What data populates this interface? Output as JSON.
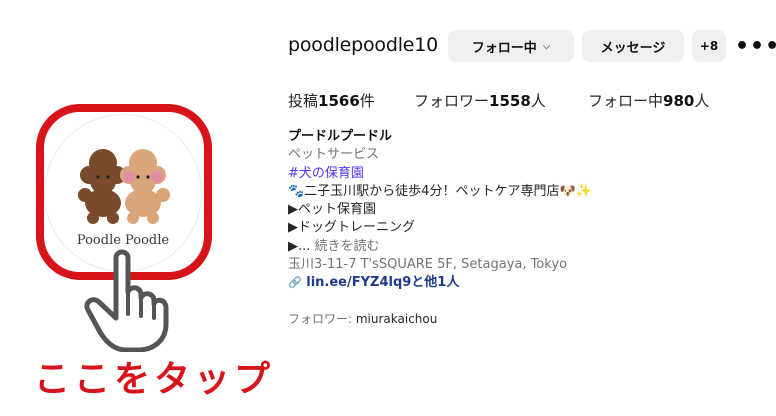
{
  "profile": {
    "username": "poodlepoodle10",
    "avatar_logo_text": "Poodle Poodle"
  },
  "actions": {
    "follow_label": "フォロー中",
    "follow_chevron": "⌵",
    "message_label": "メッセージ",
    "adduser_icon": "+8",
    "more_icon": "•••"
  },
  "stats": {
    "posts_label": "投稿",
    "posts_value": "1566",
    "posts_unit": "件",
    "followers_label": "フォロワー",
    "followers_value": "1558",
    "followers_unit": "人",
    "following_label": "フォロー中",
    "following_value": "980",
    "following_unit": "人"
  },
  "bio": {
    "name": "プードルプードル",
    "category": "ペットサービス",
    "hashtag": "#犬の保育園",
    "line1": "🐾二子玉川駅から徒歩4分！ペットケア専門店🐶✨",
    "line2": "▶ペット保育園",
    "line3": "▶ドッグトレーニング",
    "line4_prefix": "▶...",
    "line4_more": "続きを読む",
    "address": "玉川3-11-7 T'sSQUARE 5F, Setagaya, Tokyo",
    "link_icon": "🔗",
    "link_text": "lin.ee/FYZ4lq9と他1人"
  },
  "followed_by": {
    "label": "フォロワー: ",
    "user": "miurakaichou"
  },
  "annotation": {
    "caption": "ここをタップ"
  },
  "colors": {
    "highlight_red": "#d8141b",
    "button_bg": "#efefef",
    "hashtag": "#4f37ff",
    "link": "#1e3a8a"
  }
}
